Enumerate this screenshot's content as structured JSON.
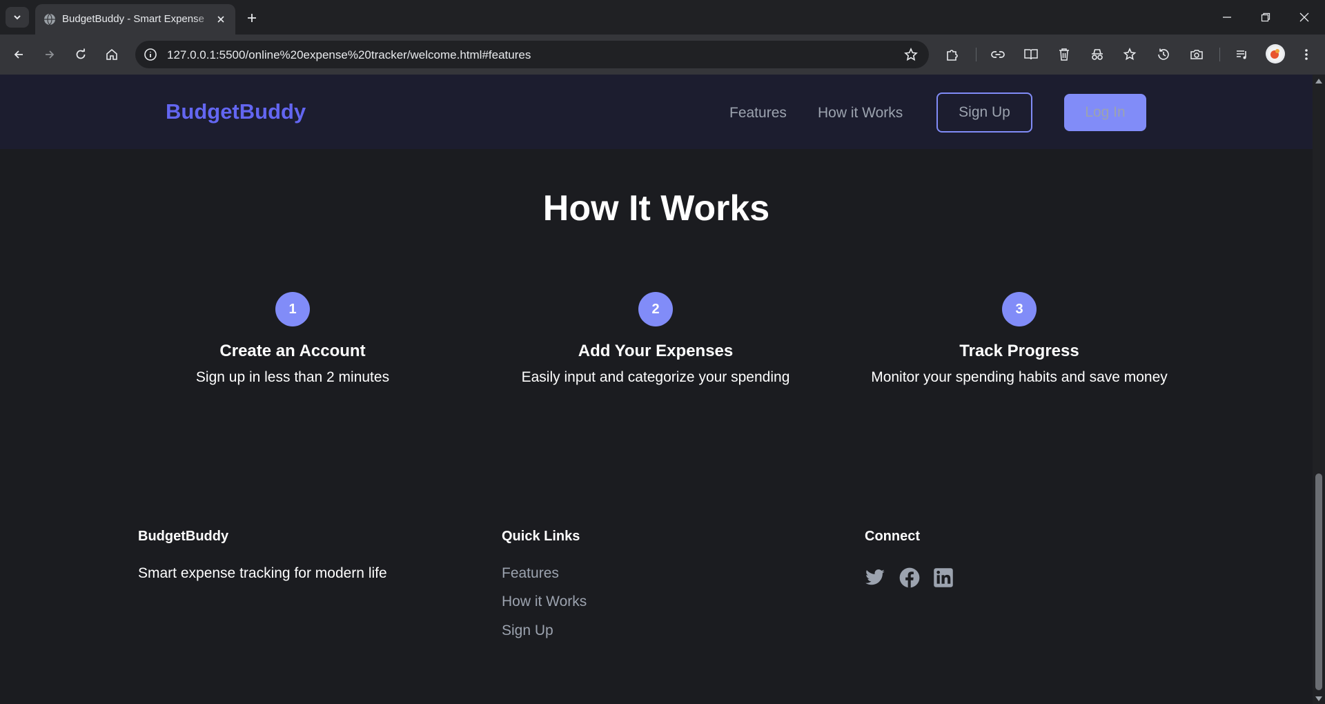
{
  "browser": {
    "tab": {
      "title": "BudgetBuddy - Smart Expense Tracker"
    },
    "address_bar": {
      "url": "127.0.0.1:5500/online%20expense%20tracker/welcome.html#features"
    },
    "colors": {
      "frame": "#202124",
      "toolbar": "#35363a",
      "text": "#e8eaed"
    }
  },
  "page": {
    "navbar": {
      "brand": "BudgetBuddy",
      "links": [
        "Features",
        "How it Works"
      ],
      "signup_label": "Sign Up",
      "login_label": "Log In"
    },
    "how_it_works": {
      "title": "How It Works",
      "steps": [
        {
          "number": "1",
          "title": "Create an Account",
          "description": "Sign up in less than 2 minutes"
        },
        {
          "number": "2",
          "title": "Add Your Expenses",
          "description": "Easily input and categorize your spending"
        },
        {
          "number": "3",
          "title": "Track Progress",
          "description": "Monitor your spending habits and save money"
        }
      ]
    },
    "footer": {
      "brand": {
        "heading": "BudgetBuddy",
        "tagline": "Smart expense tracking for modern life"
      },
      "quick_links": {
        "heading": "Quick Links",
        "links": [
          "Features",
          "How it Works",
          "Sign Up"
        ]
      },
      "connect": {
        "heading": "Connect",
        "icons": [
          "twitter-icon",
          "facebook-icon",
          "linkedin-icon"
        ]
      }
    },
    "colors": {
      "accent": "#6366f1",
      "accent_light": "#818cf8",
      "background": "#1b1c20",
      "navbar": "#1c1d2f",
      "muted_text": "#9ca3af"
    }
  }
}
